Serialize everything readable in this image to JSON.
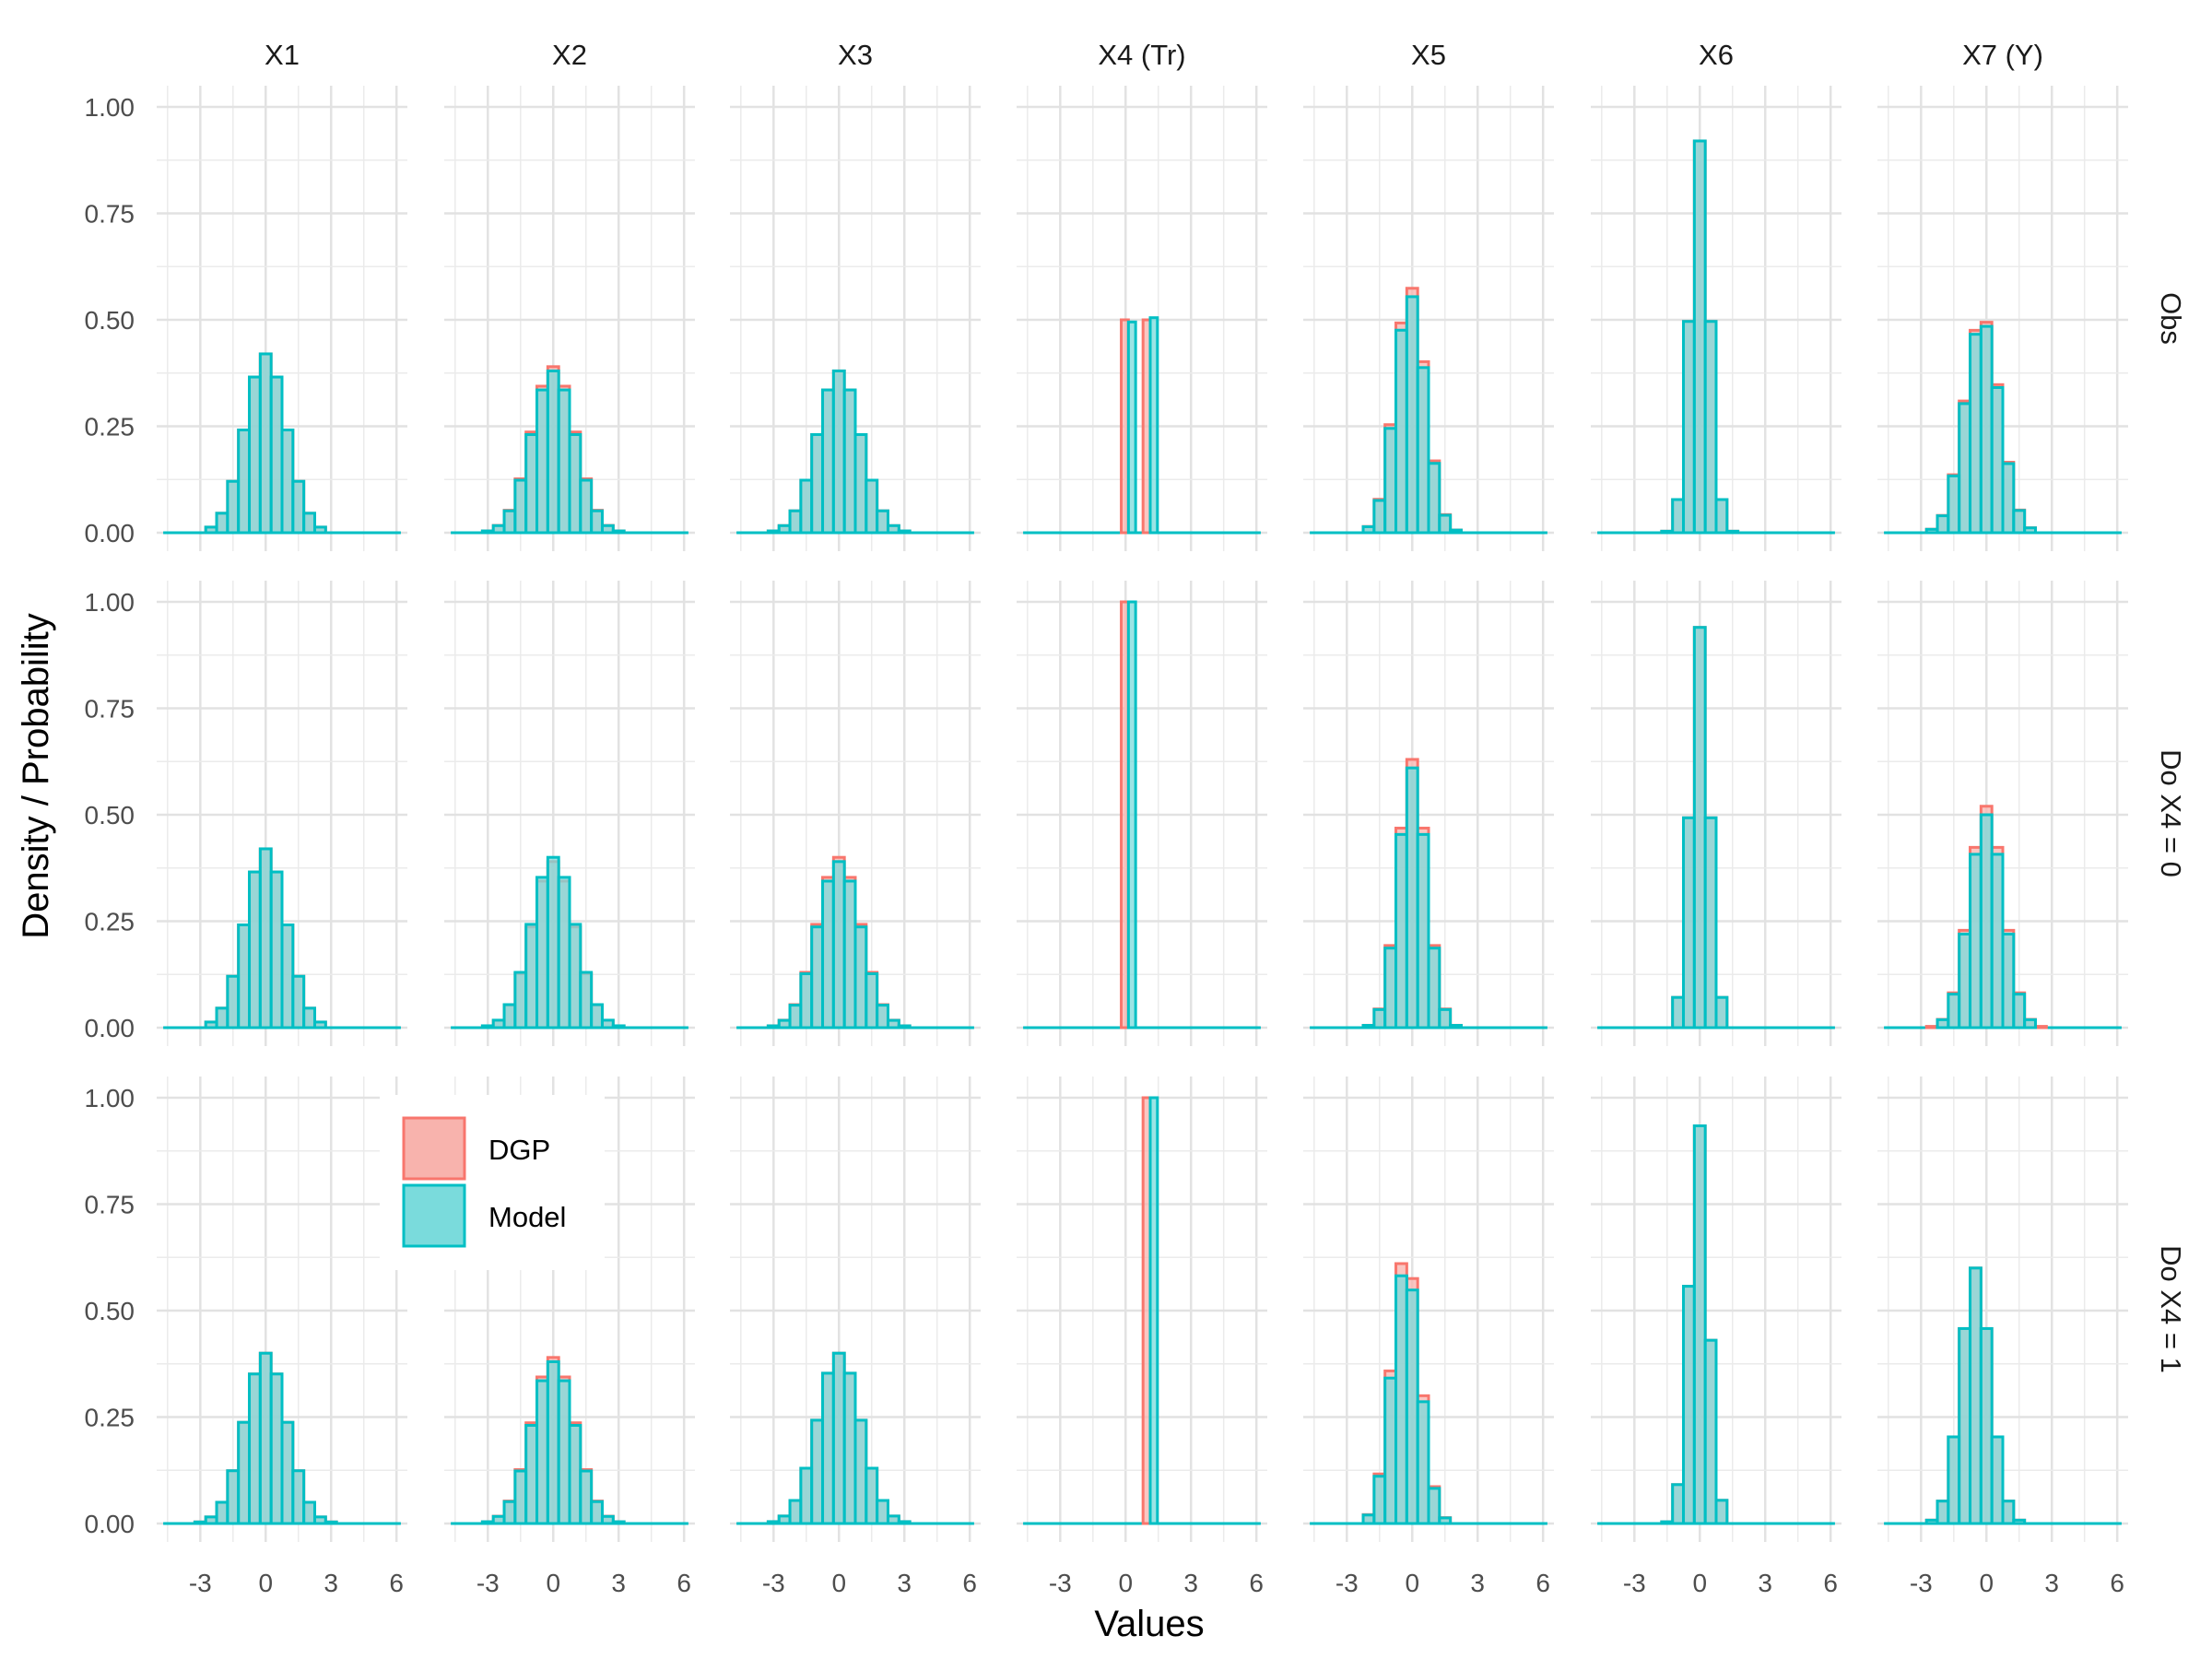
{
  "chart_data": {
    "type": "histogram-facet-grid",
    "xlabel": "Values",
    "ylabel": "Density / Probability",
    "column_labels": [
      "X1",
      "X2",
      "X3",
      "X4 (Tr)",
      "X5",
      "X6",
      "X7 (Y)"
    ],
    "row_labels": [
      "Obs",
      "Do X4 = 0",
      "Do X4 = 1"
    ],
    "xlim": [
      -5,
      6.5
    ],
    "ylim": [
      0,
      1.0
    ],
    "x_ticks": [
      -3,
      0,
      3,
      6
    ],
    "x_tick_labels": [
      "-3",
      "0",
      "3",
      "6"
    ],
    "y_ticks": [
      0,
      0.25,
      0.5,
      0.75,
      1.0
    ],
    "y_tick_labels": [
      "0.00",
      "0.25",
      "0.50",
      "0.75",
      "1.00"
    ],
    "grid": true,
    "legend": {
      "position": "inside-bottom-left",
      "entries": [
        {
          "name": "DGP",
          "fill": "#f8b3ad",
          "stroke": "#f8766d"
        },
        {
          "name": "Model",
          "fill": "#7adbdc",
          "stroke": "#00bfc4"
        }
      ]
    },
    "colors": {
      "DGP_fill": "#f8b3ad",
      "DGP_stroke": "#f8766d",
      "Model_fill": "#7adbdc",
      "Model_stroke": "#00bfc4"
    },
    "bin_width": 0.5,
    "panels": [
      [
        {
          "col": "X1",
          "row": "Obs",
          "kind": "normal",
          "mu": 0.0,
          "sd": 0.95,
          "dgp_peak": 0.42,
          "model_peak": 0.42
        },
        {
          "col": "X2",
          "row": "Obs",
          "kind": "normal",
          "mu": 0.0,
          "sd": 1.0,
          "dgp_peak": 0.39,
          "model_peak": 0.38
        },
        {
          "col": "X3",
          "row": "Obs",
          "kind": "normal",
          "mu": 0.0,
          "sd": 1.0,
          "dgp_peak": 0.38,
          "model_peak": 0.38
        },
        {
          "col": "X4 (Tr)",
          "row": "Obs",
          "kind": "binary",
          "dgp": [
            {
              "x": 0,
              "p": 0.5
            },
            {
              "x": 1,
              "p": 0.5
            }
          ],
          "model": [
            {
              "x": 0,
              "p": 0.495
            },
            {
              "x": 1,
              "p": 0.505
            }
          ]
        },
        {
          "col": "X5",
          "row": "Obs",
          "kind": "normal",
          "mu": -0.1,
          "sd": 0.7,
          "dgp_peak": 0.58,
          "model_peak": 0.56
        },
        {
          "col": "X6",
          "row": "Obs",
          "kind": "normal",
          "mu": 0.0,
          "sd": 0.45,
          "dgp_peak": 0.92,
          "model_peak": 0.92
        },
        {
          "col": "X7 (Y)",
          "row": "Obs",
          "kind": "normal",
          "mu": -0.2,
          "sd": 0.8,
          "dgp_peak": 0.51,
          "model_peak": 0.5
        }
      ],
      [
        {
          "col": "X1",
          "row": "Do X4 = 0",
          "kind": "normal",
          "mu": 0.0,
          "sd": 0.95,
          "dgp_peak": 0.42,
          "model_peak": 0.42
        },
        {
          "col": "X2",
          "row": "Do X4 = 0",
          "kind": "normal",
          "mu": 0.0,
          "sd": 1.0,
          "dgp_peak": 0.39,
          "model_peak": 0.4
        },
        {
          "col": "X3",
          "row": "Do X4 = 0",
          "kind": "normal",
          "mu": 0.0,
          "sd": 1.0,
          "dgp_peak": 0.4,
          "model_peak": 0.39
        },
        {
          "col": "X4 (Tr)",
          "row": "Do X4 = 0",
          "kind": "binary",
          "dgp": [
            {
              "x": 0,
              "p": 1.0
            }
          ],
          "model": [
            {
              "x": 0,
              "p": 1.0
            }
          ]
        },
        {
          "col": "X5",
          "row": "Do X4 = 0",
          "kind": "normal",
          "mu": 0.0,
          "sd": 0.65,
          "dgp_peak": 0.63,
          "model_peak": 0.61
        },
        {
          "col": "X6",
          "row": "Do X4 = 0",
          "kind": "normal",
          "mu": 0.0,
          "sd": 0.44,
          "dgp_peak": 0.94,
          "model_peak": 0.94
        },
        {
          "col": "X7 (Y)",
          "row": "Do X4 = 0",
          "kind": "normal",
          "mu": 0.0,
          "sd": 0.78,
          "dgp_peak": 0.52,
          "model_peak": 0.5
        }
      ],
      [
        {
          "col": "X1",
          "row": "Do X4 = 1",
          "kind": "normal",
          "mu": 0.0,
          "sd": 0.98,
          "dgp_peak": 0.4,
          "model_peak": 0.4
        },
        {
          "col": "X2",
          "row": "Do X4 = 1",
          "kind": "normal",
          "mu": 0.0,
          "sd": 1.0,
          "dgp_peak": 0.39,
          "model_peak": 0.38
        },
        {
          "col": "X3",
          "row": "Do X4 = 1",
          "kind": "normal",
          "mu": 0.0,
          "sd": 1.0,
          "dgp_peak": 0.4,
          "model_peak": 0.4
        },
        {
          "col": "X4 (Tr)",
          "row": "Do X4 = 1",
          "kind": "binary",
          "dgp": [
            {
              "x": 1,
              "p": 1.0
            }
          ],
          "model": [
            {
              "x": 1,
              "p": 1.0
            }
          ]
        },
        {
          "col": "X5",
          "row": "Do X4 = 1",
          "kind": "normal",
          "mu": -0.3,
          "sd": 0.65,
          "dgp_peak": 0.64,
          "model_peak": 0.61
        },
        {
          "col": "X6",
          "row": "Do X4 = 1",
          "kind": "normal",
          "mu": -0.05,
          "sd": 0.44,
          "dgp_peak": 0.94,
          "model_peak": 0.94
        },
        {
          "col": "X7 (Y)",
          "row": "Do X4 = 1",
          "kind": "normal",
          "mu": -0.5,
          "sd": 0.68,
          "dgp_peak": 0.6,
          "model_peak": 0.6
        }
      ]
    ]
  }
}
